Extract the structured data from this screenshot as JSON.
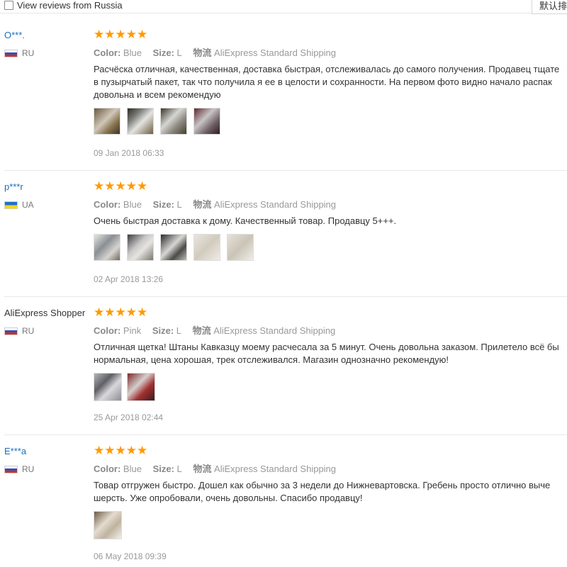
{
  "topbar": {
    "checkbox_label": "View reviews from Russia",
    "sort_label": "默认排"
  },
  "labels": {
    "color": "Color:",
    "size": "Size:",
    "shipping": "物流"
  },
  "stars_glyph": "★★★★★",
  "reviews": [
    {
      "name": "O***.",
      "country": "RU",
      "color": "Blue",
      "size": "L",
      "shipping": "AliExpress Standard Shipping",
      "lines": [
        "Расчёска отличная, качественная, доставка быстрая, отслеживалась до самого получения. Продавец тщате",
        "в пузырчатый пакет, так что получила я ее в целости и сохранности. На первом фото видно начало распак",
        "довольна и всем рекомендую"
      ],
      "date": "09 Jan 2018 06:33"
    },
    {
      "name": "p***r",
      "country": "UA",
      "color": "Blue",
      "size": "L",
      "shipping": "AliExpress Standard Shipping",
      "lines": [
        "Очень быстрая доставка к дому. Качественный товар. Продавцу 5+++."
      ],
      "date": "02 Apr 2018 13:26"
    },
    {
      "name": "AliExpress Shopper",
      "country": "RU",
      "color": "Pink",
      "size": "L",
      "shipping": "AliExpress Standard Shipping",
      "lines": [
        "Отличная щетка! Штаны Кавказцу моему расчесала за 5 минут. Очень довольна заказом. Прилетело всё бы",
        "нормальная, цена хорошая, трек отслеживался. Магазин однозначно рекомендую!"
      ],
      "date": "25 Apr 2018 02:44"
    },
    {
      "name": "E***a",
      "country": "RU",
      "color": "Blue",
      "size": "L",
      "shipping": "AliExpress Standard Shipping",
      "lines": [
        "Товар отгружен быстро. Дошел как обычно за 3 недели до Нижневартовска. Гребень просто отлично выче",
        "шерсть. Уже опробовали, очень довольны. Спасибо продавцу!"
      ],
      "date": "06 May 2018 09:39"
    }
  ]
}
